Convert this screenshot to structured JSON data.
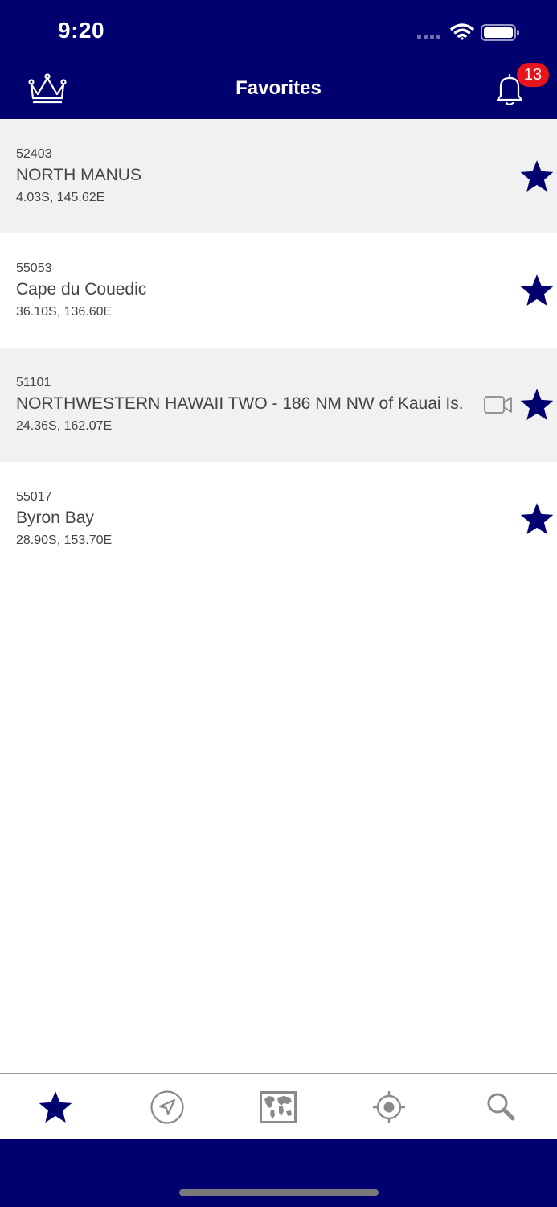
{
  "status_bar": {
    "time": "9:20"
  },
  "nav": {
    "title": "Favorites",
    "notification_count": "13"
  },
  "favorites": [
    {
      "id": "52403",
      "name": "NORTH MANUS",
      "coords": "4.03S, 145.62E",
      "has_video": false
    },
    {
      "id": "55053",
      "name": "Cape du Couedic",
      "coords": "36.10S, 136.60E",
      "has_video": false
    },
    {
      "id": "51101",
      "name": "NORTHWESTERN HAWAII TWO - 186 NM NW of Kauai Is.",
      "coords": "24.36S, 162.07E",
      "has_video": true
    },
    {
      "id": "55017",
      "name": "Byron Bay",
      "coords": "28.90S, 153.70E",
      "has_video": false
    }
  ],
  "tabs": [
    {
      "icon": "star-icon",
      "active": true
    },
    {
      "icon": "navigation-arrow-icon",
      "active": false
    },
    {
      "icon": "world-map-icon",
      "active": false
    },
    {
      "icon": "location-target-icon",
      "active": false
    },
    {
      "icon": "search-icon",
      "active": false
    }
  ],
  "colors": {
    "primary": "#00006e",
    "badge": "#e8141b",
    "row_shaded": "#f1f1f1",
    "inactive_icon": "#8a8a8a"
  }
}
